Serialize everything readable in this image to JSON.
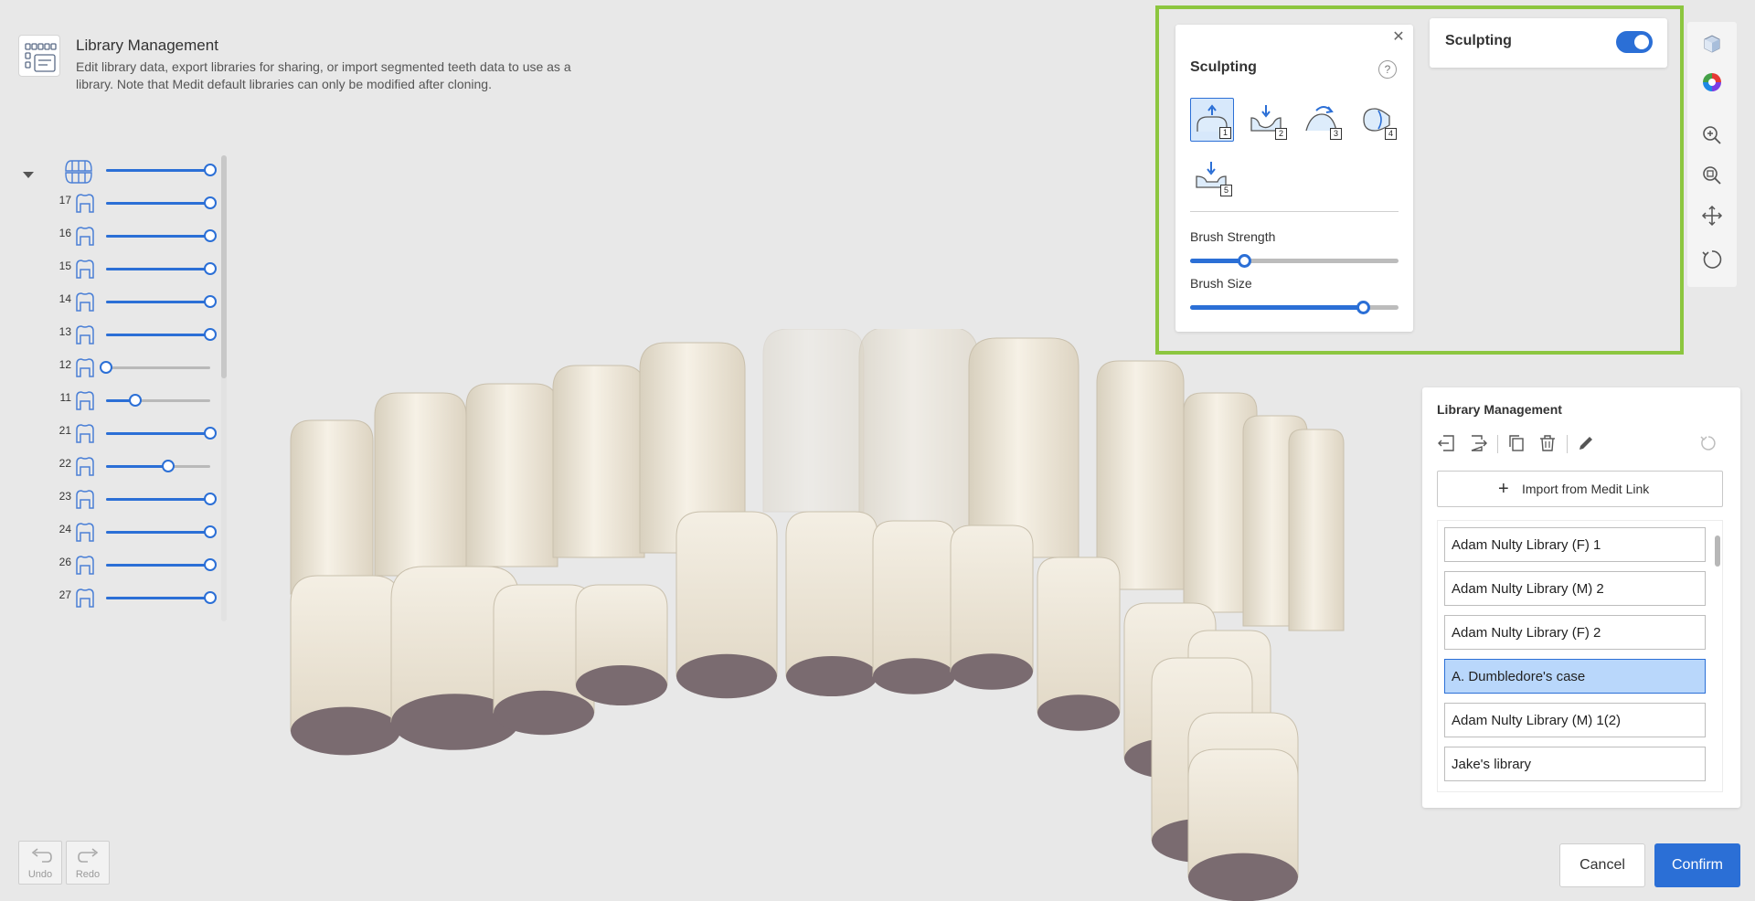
{
  "header": {
    "title": "Library Management",
    "description": "Edit library data, export libraries for sharing, or import segmented teeth data to use as a library. Note that Medit default libraries can only be modified after cloning."
  },
  "teeth": {
    "all_opacity": 1.0,
    "rows": [
      {
        "num": "17",
        "opacity": 1.0
      },
      {
        "num": "16",
        "opacity": 1.0
      },
      {
        "num": "15",
        "opacity": 1.0
      },
      {
        "num": "14",
        "opacity": 1.0
      },
      {
        "num": "13",
        "opacity": 1.0
      },
      {
        "num": "12",
        "opacity": 0.0
      },
      {
        "num": "11",
        "opacity": 0.28
      },
      {
        "num": "21",
        "opacity": 1.0
      },
      {
        "num": "22",
        "opacity": 0.6
      },
      {
        "num": "23",
        "opacity": 1.0
      },
      {
        "num": "24",
        "opacity": 1.0
      },
      {
        "num": "26",
        "opacity": 1.0
      },
      {
        "num": "27",
        "opacity": 1.0
      }
    ]
  },
  "sculpting": {
    "title": "Sculpting",
    "tools": [
      {
        "key": "1",
        "icon": "add-material-icon",
        "active": true
      },
      {
        "key": "2",
        "icon": "remove-material-icon",
        "active": false
      },
      {
        "key": "3",
        "icon": "smooth-icon",
        "active": false
      },
      {
        "key": "4",
        "icon": "morph-icon",
        "active": false
      },
      {
        "key": "5",
        "icon": "flatten-icon",
        "active": false
      }
    ],
    "brush_strength_label": "Brush Strength",
    "brush_strength": 0.26,
    "brush_size_label": "Brush Size",
    "brush_size": 0.83
  },
  "toggle": {
    "label": "Sculpting",
    "on": true
  },
  "library": {
    "title": "Library Management",
    "import_label": "Import from Medit Link",
    "items": [
      {
        "name": "Adam Nulty Library (F) 1",
        "selected": false
      },
      {
        "name": "Adam Nulty Library (M) 2",
        "selected": false
      },
      {
        "name": "Adam Nulty Library (F) 2",
        "selected": false
      },
      {
        "name": "A. Dumbledore's case",
        "selected": true
      },
      {
        "name": "Adam Nulty Library (M) 1(2)",
        "selected": false
      },
      {
        "name": "Jake's library",
        "selected": false
      }
    ]
  },
  "history": {
    "undo": "Undo",
    "redo": "Redo"
  },
  "actions": {
    "cancel": "Cancel",
    "confirm": "Confirm"
  },
  "colors": {
    "accent": "#2b6fd6",
    "highlight": "#8cc63f",
    "tooth": "#efe8d9",
    "tooth_base": "#7a6b70"
  }
}
